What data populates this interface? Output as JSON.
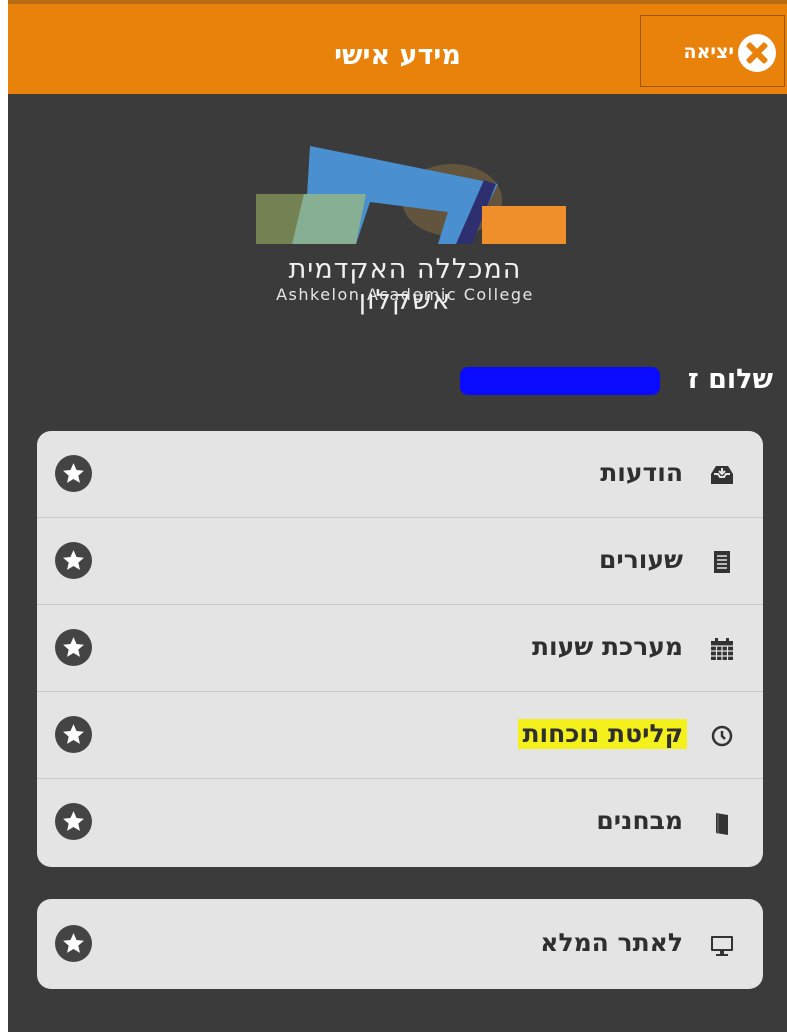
{
  "header": {
    "title": "מידע אישי",
    "exit_label": "יציאה"
  },
  "logo": {
    "hebrew_name": "המכללה האקדמית אשקלון",
    "english_name": "Ashkelon Academic College"
  },
  "greeting": "שלום ז",
  "menu": {
    "items": [
      {
        "label": "הודעות",
        "icon": "inbox-icon"
      },
      {
        "label": "שעורים",
        "icon": "document-icon"
      },
      {
        "label": "מערכת שעות",
        "icon": "calendar-icon"
      },
      {
        "label": "קליטת נוכחות",
        "icon": "clock-icon",
        "highlighted": true
      },
      {
        "label": "מבחנים",
        "icon": "book-icon"
      }
    ],
    "secondary": [
      {
        "label": "לאתר המלא",
        "icon": "monitor-icon"
      }
    ]
  },
  "colors": {
    "header": "#e8820b",
    "background": "#3b3b3b",
    "card": "#e4e4e4",
    "highlight": "#f3f01c"
  }
}
